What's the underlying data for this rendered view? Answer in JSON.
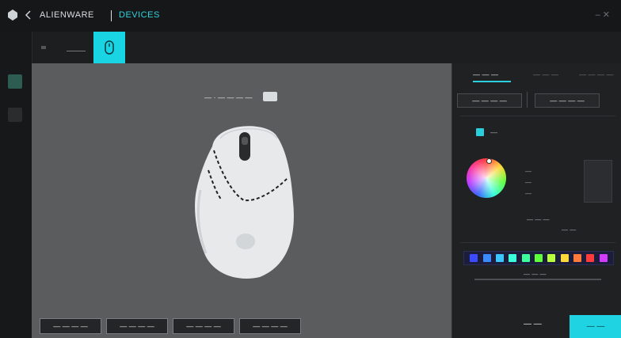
{
  "titlebar": {
    "app_name": "ALIENWARE",
    "section": "DEVICES",
    "window_controls": "–  ✕"
  },
  "canvas": {
    "dpi_label": "— · — — — —",
    "buttons": [
      "— — — —",
      "— — — —",
      "— — — —",
      "— — — —"
    ]
  },
  "panel": {
    "tabs": [
      "— — —",
      "— — —",
      "— — — —"
    ],
    "mode_buttons": [
      "— — — —",
      "— — — —"
    ],
    "zone_label": "—",
    "rgb_labels": [
      "—",
      "—",
      "—"
    ],
    "hex_label": "— — —",
    "small_label": "— —",
    "brightness_label": "— — —",
    "reset_label": "— —",
    "apply_label": "— —"
  },
  "swatches": [
    "#3b4bff",
    "#3b8bff",
    "#3bc6ff",
    "#3bffdb",
    "#3bff9a",
    "#5dff3b",
    "#b7ff3b",
    "#ffd93b",
    "#ff7a3b",
    "#ff3b3b",
    "#d33bff"
  ],
  "colors": {
    "accent": "#1fd3e3",
    "canvas": "#5a5c5e",
    "panel": "#202123"
  }
}
